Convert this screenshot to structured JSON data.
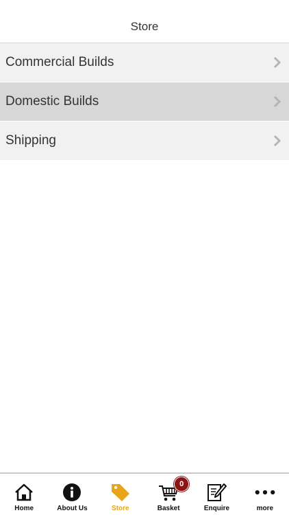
{
  "header": {
    "title": "Store"
  },
  "list": {
    "items": [
      {
        "label": "Commercial Builds",
        "shade": "light"
      },
      {
        "label": "Domestic Builds",
        "shade": "dark"
      },
      {
        "label": "Shipping",
        "shade": "light"
      }
    ]
  },
  "tabbar": {
    "tabs": [
      {
        "label": "Home",
        "icon": "home-icon"
      },
      {
        "label": "About Us",
        "icon": "info-icon"
      },
      {
        "label": "Store",
        "icon": "tag-icon",
        "active": true
      },
      {
        "label": "Basket",
        "icon": "cart-icon",
        "badge": "0"
      },
      {
        "label": "Enquire",
        "icon": "edit-icon"
      },
      {
        "label": "more",
        "icon": "more-icon"
      }
    ]
  },
  "colors": {
    "accent": "#e8a517",
    "badge": "#8d1414",
    "row_light": "#f1f1f1",
    "row_selected": "#d7d7d7"
  }
}
